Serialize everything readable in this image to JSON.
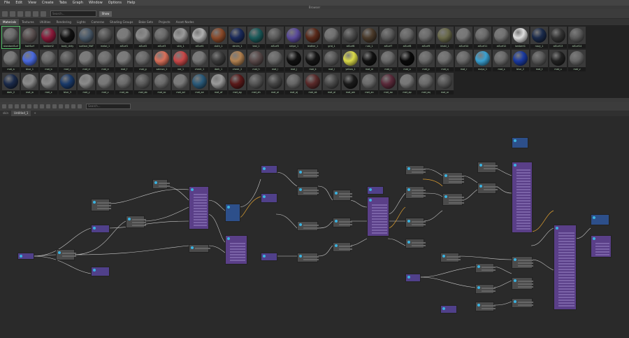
{
  "app": {
    "window_title": "Browser"
  },
  "menu": [
    "File",
    "Edit",
    "View",
    "Create",
    "Tabs",
    "Graph",
    "Window",
    "Options",
    "Help"
  ],
  "toolbar": {
    "search_placeholder": "Search...",
    "show_label": "Show"
  },
  "browser_tabs": [
    {
      "label": "Materials",
      "active": true
    },
    {
      "label": "Textures"
    },
    {
      "label": "Utilities"
    },
    {
      "label": "Rendering"
    },
    {
      "label": "Lights"
    },
    {
      "label": "Cameras"
    },
    {
      "label": "Shading Groups"
    },
    {
      "label": "Bake Sets"
    },
    {
      "label": "Projects"
    },
    {
      "label": "Asset Nodes"
    }
  ],
  "materials": [
    {
      "name": "standardSurf",
      "color": "#6a6a6a"
    },
    {
      "name": "hairSurf",
      "color": "#5a5050"
    },
    {
      "name": "lambert2",
      "color": "#8a1a3a"
    },
    {
      "name": "body_dirty",
      "color": "#111111"
    },
    {
      "name": "surface_MAT",
      "color": "#4a5a6a"
    },
    {
      "name": "metal_1",
      "color": "#555555"
    },
    {
      "name": "aiSurf1",
      "color": "#7a7a7a"
    },
    {
      "name": "aiSurf2",
      "color": "#8a8a8a"
    },
    {
      "name": "aiSurf3",
      "color": "#6a6a6a"
    },
    {
      "name": "skin_1",
      "color": "#9a9a9a"
    },
    {
      "name": "aiSurf4",
      "color": "#b0b0b0"
    },
    {
      "name": "cloth_1",
      "color": "#8a4a2a"
    },
    {
      "name": "denim_1",
      "color": "#1a2a5a"
    },
    {
      "name": "teal_1",
      "color": "#1a5a5a"
    },
    {
      "name": "aiSurf5",
      "color": "#5a5a5a"
    },
    {
      "name": "stripe_1",
      "color": "#5a4a9a"
    },
    {
      "name": "leather_1",
      "color": "#5a2a1a"
    },
    {
      "name": "grid_1",
      "color": "#707070"
    },
    {
      "name": "aiSurf6",
      "color": "#4a4a4a"
    },
    {
      "name": "rust_1",
      "color": "#4a3a2a"
    },
    {
      "name": "aiSurf7",
      "color": "#5a5a5a"
    },
    {
      "name": "aiSurf8",
      "color": "#666666"
    },
    {
      "name": "aiSurf9",
      "color": "#6a6a6a"
    },
    {
      "name": "khaki_1",
      "color": "#6a6a4a"
    },
    {
      "name": "aiSurf10",
      "color": "#777777"
    },
    {
      "name": "aiSurf11",
      "color": "#6a6a6a"
    },
    {
      "name": "aiSurf12",
      "color": "#727272"
    },
    {
      "name": "lambert1",
      "color": "#dddddd"
    },
    {
      "name": "navy_1",
      "color": "#1a2a4a"
    },
    {
      "name": "aiSurf13",
      "color": "#333333"
    },
    {
      "name": "aiSurf14",
      "color": "#5a5a5a"
    },
    {
      "name": "mat_a",
      "color": "#777777"
    },
    {
      "name": "blue_1",
      "color": "#4a6adf"
    },
    {
      "name": "mat_b",
      "color": "#6a6a6a"
    },
    {
      "name": "mat_c",
      "color": "#5a5a5a"
    },
    {
      "name": "mat_d",
      "color": "#7a7a7a"
    },
    {
      "name": "mat_e",
      "color": "#6f6f6f"
    },
    {
      "name": "mat_f",
      "color": "#7a7a7a"
    },
    {
      "name": "mat_g",
      "color": "#6a6a6a"
    },
    {
      "name": "salmon_1",
      "color": "#d8705a"
    },
    {
      "name": "red_1",
      "color": "#c84848"
    },
    {
      "name": "check_1",
      "color": "#777777"
    },
    {
      "name": "dark_1",
      "color": "#3a3a3a"
    },
    {
      "name": "check_2",
      "color": "#b08050"
    },
    {
      "name": "mat_h",
      "color": "#5a4a4a"
    },
    {
      "name": "mat_i",
      "color": "#6a6a6a"
    },
    {
      "name": "mat_j",
      "color": "#111111"
    },
    {
      "name": "mat_k",
      "color": "#151515"
    },
    {
      "name": "mat_l",
      "color": "#5a5a5a"
    },
    {
      "name": "yellow_1",
      "color": "#dada4a"
    },
    {
      "name": "mat_m",
      "color": "#111111"
    },
    {
      "name": "mat_n",
      "color": "#6a6a6a"
    },
    {
      "name": "mat_o",
      "color": "#0a0a0a"
    },
    {
      "name": "mat_p",
      "color": "#6a6a6a"
    },
    {
      "name": "mat_q",
      "color": "#707070"
    },
    {
      "name": "mat_r",
      "color": "#6a6a6a"
    },
    {
      "name": "maya_1",
      "color": "#3aa0d0"
    },
    {
      "name": "mat_s",
      "color": "#6a6a6a"
    },
    {
      "name": "blue_2",
      "color": "#1a3aa0"
    },
    {
      "name": "mat_t",
      "color": "#5a5a5a"
    },
    {
      "name": "mat_u",
      "color": "#222222"
    },
    {
      "name": "mat_v",
      "color": "#666666"
    },
    {
      "name": "dark_2",
      "color": "#1a2a4a"
    },
    {
      "name": "mat_w",
      "color": "#8a8a8a"
    },
    {
      "name": "mat_x",
      "color": "#8a8a8a"
    },
    {
      "name": "blue_3",
      "color": "#1a3a6a"
    },
    {
      "name": "mat_y",
      "color": "#8a8a8a"
    },
    {
      "name": "mat_z",
      "color": "#777777"
    },
    {
      "name": "mat_aa",
      "color": "#6a6a6a"
    },
    {
      "name": "mat_ab",
      "color": "#5a5a5a"
    },
    {
      "name": "mat_ac",
      "color": "#6a6a6a"
    },
    {
      "name": "mat_ad",
      "color": "#7a7a7a"
    },
    {
      "name": "mat_ae",
      "color": "#2a5a7a"
    },
    {
      "name": "mat_af",
      "color": "#9a9a9a"
    },
    {
      "name": "mat_ag",
      "color": "#5a1a1a"
    },
    {
      "name": "mat_ah",
      "color": "#555555"
    },
    {
      "name": "mat_ai",
      "color": "#444444"
    },
    {
      "name": "mat_aj",
      "color": "#666666"
    },
    {
      "name": "mat_ak",
      "color": "#5a2a2a"
    },
    {
      "name": "mat_al",
      "color": "#4a4a4a"
    },
    {
      "name": "mat_am",
      "color": "#1a1a1a"
    },
    {
      "name": "mat_an",
      "color": "#6a6a6a"
    },
    {
      "name": "mat_ao",
      "color": "#5a2a3a"
    },
    {
      "name": "mat_ap",
      "color": "#777777"
    },
    {
      "name": "mat_aq",
      "color": "#6a6a6a"
    },
    {
      "name": "mat_ar",
      "color": "#555555"
    }
  ],
  "node_editor": {
    "search_placeholder": "Search...",
    "tabs": [
      {
        "label": "skin"
      },
      {
        "label": "Untitled_1",
        "active": true
      },
      {
        "label": "+"
      }
    ]
  }
}
